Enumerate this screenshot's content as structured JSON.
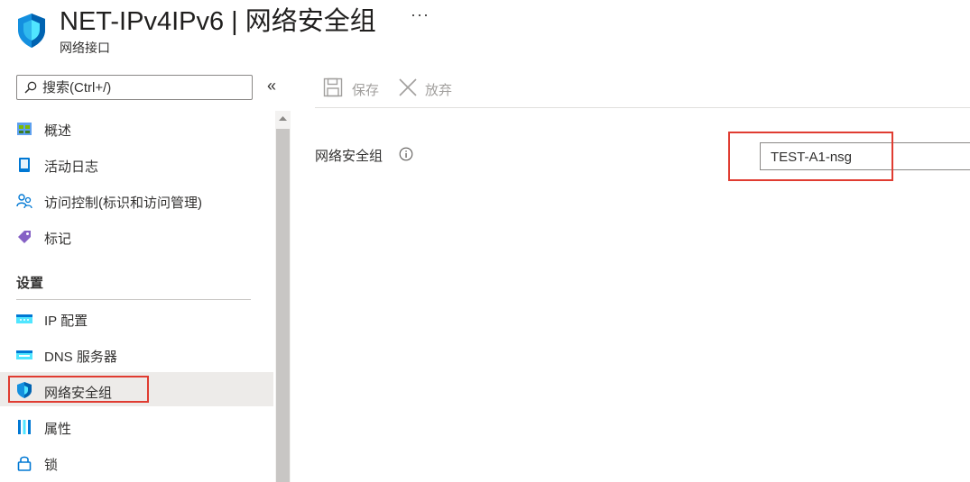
{
  "header": {
    "title": "NET-IPv4IPv6 | 网络安全组",
    "subtitle": "网络接口",
    "more_label": "···"
  },
  "sidebar": {
    "search_placeholder": "搜索(Ctrl+/)",
    "collapse_label": "«",
    "items": [
      {
        "label": "概述",
        "icon": "overview-icon"
      },
      {
        "label": "活动日志",
        "icon": "activity-log-icon"
      },
      {
        "label": "访问控制(标识和访问管理)",
        "icon": "access-control-icon"
      },
      {
        "label": "标记",
        "icon": "tag-icon"
      }
    ],
    "settings_header": "设置",
    "settings_items": [
      {
        "label": "IP 配置",
        "icon": "ip-config-icon"
      },
      {
        "label": "DNS 服务器",
        "icon": "dns-icon"
      },
      {
        "label": "网络安全组",
        "icon": "shield-icon",
        "selected": true
      },
      {
        "label": "属性",
        "icon": "properties-icon"
      },
      {
        "label": "锁",
        "icon": "lock-icon"
      }
    ]
  },
  "toolbar": {
    "save_label": "保存",
    "discard_label": "放弃"
  },
  "form": {
    "nsg_label": "网络安全组",
    "nsg_value": "TEST-A1-nsg"
  },
  "colors": {
    "accent": "#0078d4",
    "highlight": "#e03c31",
    "selected_bg": "#edebe9"
  }
}
